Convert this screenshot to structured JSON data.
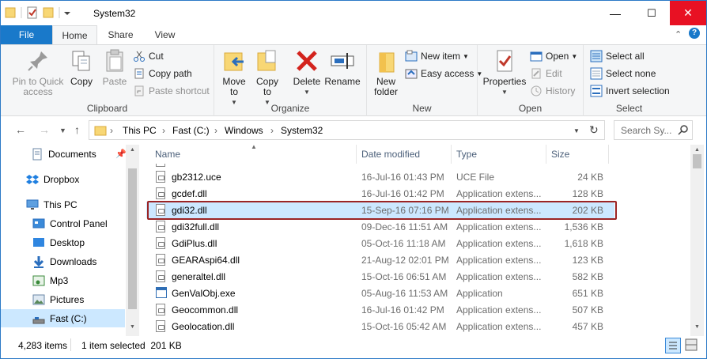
{
  "window": {
    "title": "System32",
    "minimize": "—",
    "maximize": "☐",
    "close": "✕"
  },
  "tabs": {
    "file": "File",
    "home": "Home",
    "share": "Share",
    "view": "View"
  },
  "ribbon": {
    "clipboard": {
      "label": "Clipboard",
      "pin": "Pin to Quick access",
      "copy": "Copy",
      "paste": "Paste",
      "cut": "Cut",
      "copy_path": "Copy path",
      "paste_shortcut": "Paste shortcut"
    },
    "organize": {
      "label": "Organize",
      "move_to": "Move to",
      "copy_to": "Copy to",
      "delete": "Delete",
      "rename": "Rename"
    },
    "new": {
      "label": "New",
      "new_folder": "New folder",
      "new_item": "New item",
      "easy_access": "Easy access"
    },
    "open": {
      "label": "Open",
      "properties": "Properties",
      "open": "Open",
      "edit": "Edit",
      "history": "History"
    },
    "select": {
      "label": "Select",
      "select_all": "Select all",
      "select_none": "Select none",
      "invert_selection": "Invert selection"
    }
  },
  "address": {
    "crumbs": [
      "This PC",
      "Fast (C:)",
      "Windows",
      "System32"
    ],
    "search_placeholder": "Search Sy..."
  },
  "nav": {
    "items": [
      {
        "label": "Documents",
        "icon": "documents-icon"
      },
      {
        "label": "Dropbox",
        "icon": "dropbox-icon"
      },
      {
        "label": "This PC",
        "icon": "computer-icon"
      },
      {
        "label": "Control Panel",
        "icon": "control-panel-icon"
      },
      {
        "label": "Desktop",
        "icon": "desktop-icon"
      },
      {
        "label": "Downloads",
        "icon": "downloads-icon"
      },
      {
        "label": "Mp3",
        "icon": "music-icon"
      },
      {
        "label": "Pictures",
        "icon": "pictures-icon"
      },
      {
        "label": "Fast (C:)",
        "icon": "drive-icon"
      }
    ]
  },
  "columns": {
    "name": "Name",
    "date": "Date modified",
    "type": "Type",
    "size": "Size"
  },
  "files": [
    {
      "name": "gb2312.uce",
      "date": "16-Jul-16 01:43 PM",
      "type": "UCE File",
      "size": "24 KB",
      "icon": "file-icon"
    },
    {
      "name": "gcdef.dll",
      "date": "16-Jul-16 01:42 PM",
      "type": "Application extens...",
      "size": "128 KB",
      "icon": "dll-icon"
    },
    {
      "name": "gdi32.dll",
      "date": "15-Sep-16 07:16 PM",
      "type": "Application extens...",
      "size": "202 KB",
      "icon": "dll-icon"
    },
    {
      "name": "gdi32full.dll",
      "date": "09-Dec-16 11:51 AM",
      "type": "Application extens...",
      "size": "1,536 KB",
      "icon": "dll-icon"
    },
    {
      "name": "GdiPlus.dll",
      "date": "05-Oct-16 11:18 AM",
      "type": "Application extens...",
      "size": "1,618 KB",
      "icon": "dll-icon"
    },
    {
      "name": "GEARAspi64.dll",
      "date": "21-Aug-12 02:01 PM",
      "type": "Application extens...",
      "size": "123 KB",
      "icon": "dll-icon"
    },
    {
      "name": "generaltel.dll",
      "date": "15-Oct-16 06:51 AM",
      "type": "Application extens...",
      "size": "582 KB",
      "icon": "dll-icon"
    },
    {
      "name": "GenValObj.exe",
      "date": "05-Aug-16 11:53 AM",
      "type": "Application",
      "size": "651 KB",
      "icon": "exe-icon"
    },
    {
      "name": "Geocommon.dll",
      "date": "16-Jul-16 01:42 PM",
      "type": "Application extens...",
      "size": "507 KB",
      "icon": "dll-icon"
    },
    {
      "name": "Geolocation.dll",
      "date": "15-Oct-16 05:42 AM",
      "type": "Application extens...",
      "size": "457 KB",
      "icon": "dll-icon"
    }
  ],
  "selected_index": 2,
  "status": {
    "count": "4,283 items",
    "selection": "1 item selected  201 KB"
  }
}
